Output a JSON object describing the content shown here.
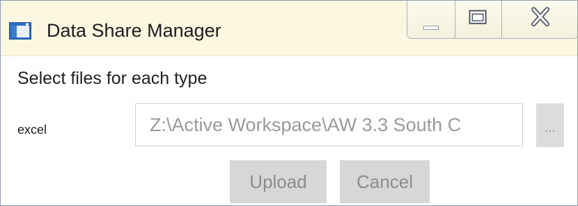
{
  "window": {
    "title": "Data Share Manager",
    "icon": "app-window-icon"
  },
  "caption_buttons": {
    "minimize_icon": "minimize-icon",
    "maximize_icon": "maximize-icon",
    "close_icon": "close-icon"
  },
  "form": {
    "heading": "Select files for each type",
    "rows": [
      {
        "label": "excel",
        "path_value": "Z:\\Active Workspace\\AW 3.3 South C",
        "browse_label": "..."
      }
    ],
    "upload_label": "Upload",
    "cancel_label": "Cancel"
  },
  "colors": {
    "titlebar_bg": "#fbf7e1",
    "button_bg": "#d7d7d7",
    "disabled_text": "#8c8c8c"
  }
}
